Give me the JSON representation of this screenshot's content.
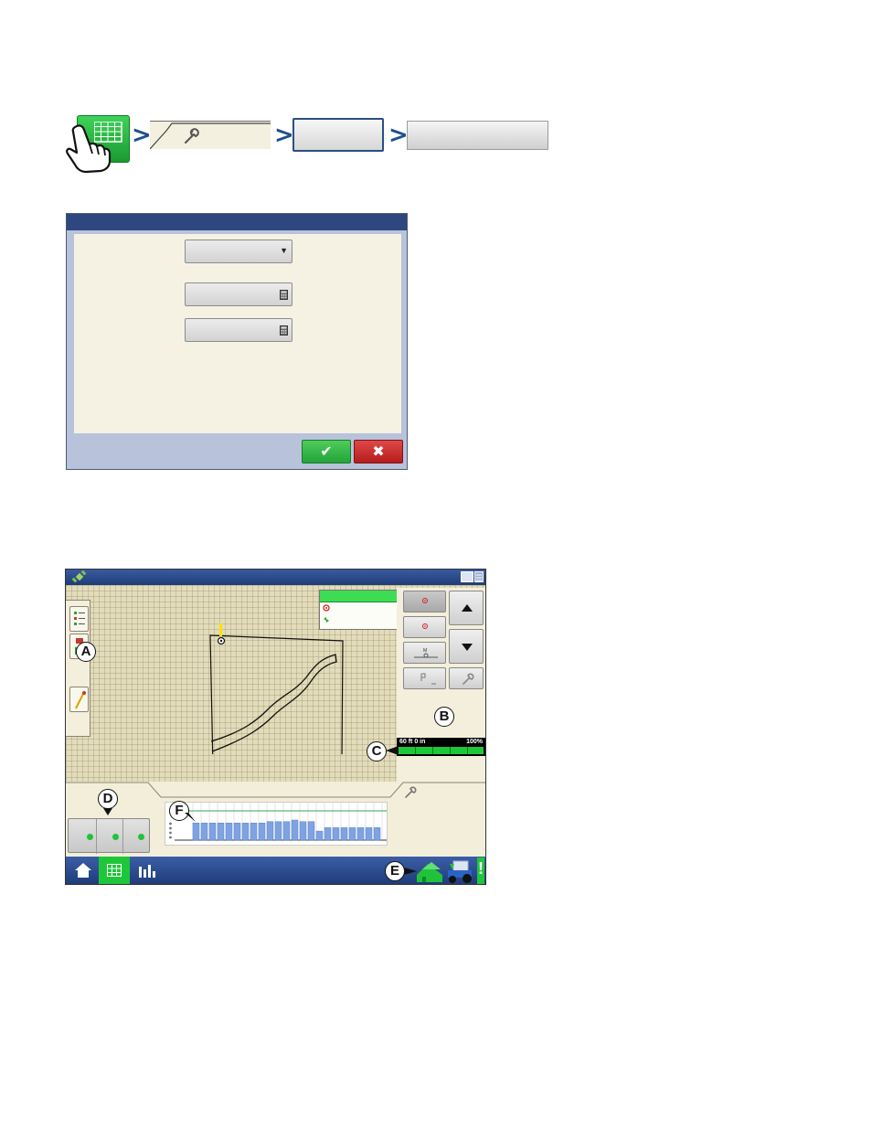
{
  "coverage": {
    "width_label": "60 ft 0 in",
    "percent_label": "100%"
  },
  "callouts": {
    "a": "A",
    "b": "B",
    "c": "C",
    "d": "D",
    "e": "E",
    "f": "F"
  },
  "rate_chart": {
    "values": [
      0.85,
      0.85,
      0.85,
      0.85,
      0.85,
      0.85,
      0.85,
      0.85,
      0.85,
      0.92,
      0.92,
      0.92,
      1.0,
      0.92,
      0.92,
      0.45,
      0.62,
      0.62,
      0.62,
      0.62,
      0.62,
      0.62,
      0.62
    ]
  },
  "colors": {
    "accent_green": "#1ec73a",
    "nav_blue": "#223f7c",
    "bar_blue": "#7fa3e2"
  }
}
